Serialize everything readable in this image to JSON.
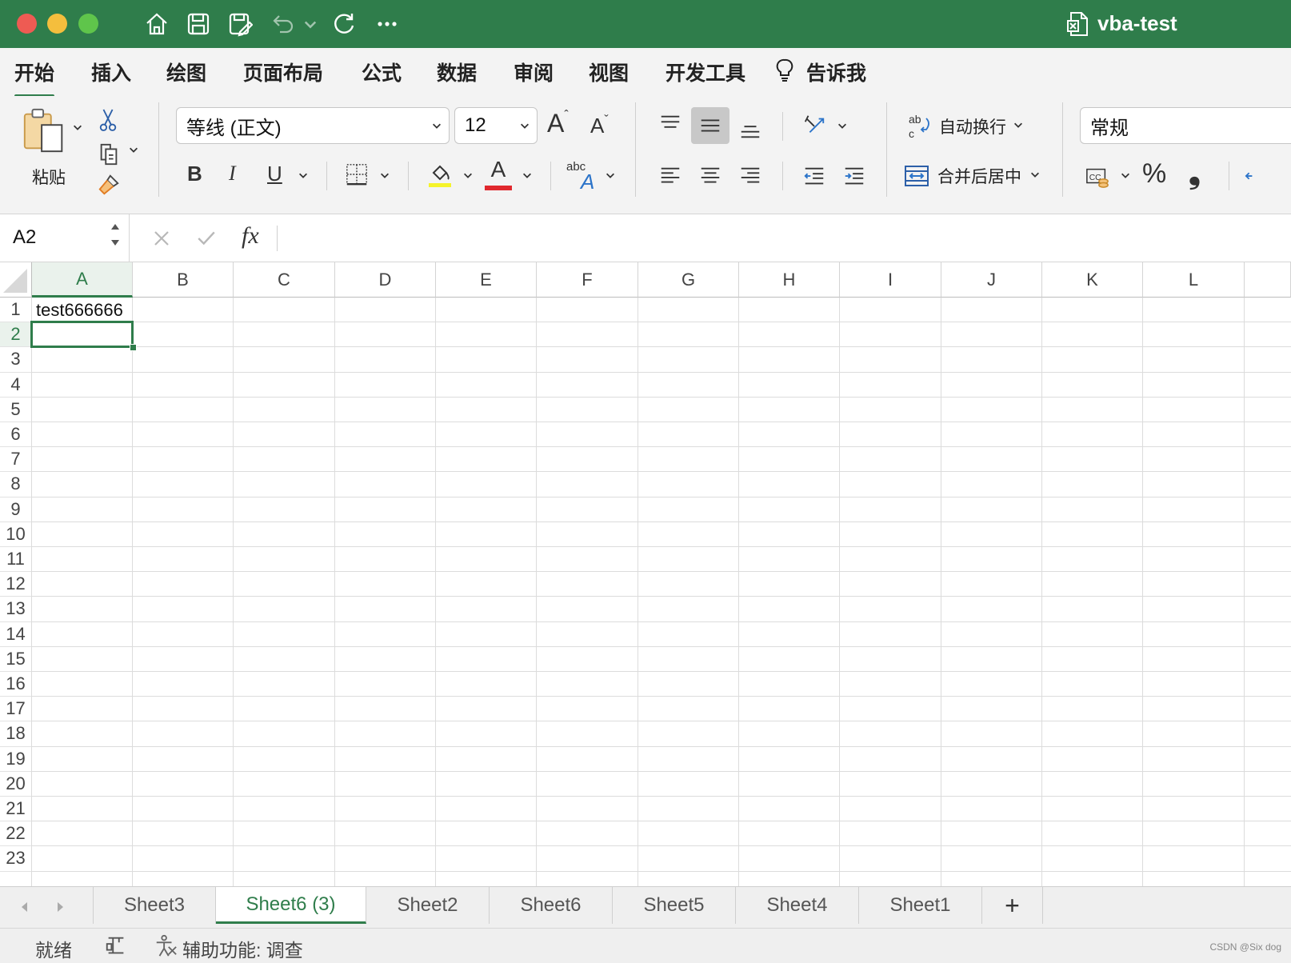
{
  "window": {
    "title": "vba-test"
  },
  "ribbon": {
    "tabs": [
      "开始",
      "插入",
      "绘图",
      "页面布局",
      "公式",
      "数据",
      "审阅",
      "视图",
      "开发工具",
      "告诉我"
    ],
    "active_tab": "开始",
    "paste_label": "粘贴",
    "font_name": "等线 (正文)",
    "font_size": "12",
    "wrap_text_label": "自动换行",
    "merge_center_label": "合并后居中",
    "number_format": "常规",
    "bold_glyph": "B",
    "italic_glyph": "I",
    "underline_glyph": "U",
    "grow_font_glyph": "A",
    "shrink_font_glyph": "A",
    "font_color_glyph": "A",
    "abc_label": "abc",
    "percent_glyph": "%",
    "comma_glyph": "❟",
    "highlight_color": "#f5f32a",
    "font_color": "#e0282e"
  },
  "formula_bar": {
    "name_box": "A2",
    "fx_label": "fx",
    "formula": ""
  },
  "grid": {
    "columns": [
      "A",
      "B",
      "C",
      "D",
      "E",
      "F",
      "G",
      "H",
      "I",
      "J",
      "K",
      "L"
    ],
    "rows": [
      "1",
      "2",
      "3",
      "4",
      "5",
      "6",
      "7",
      "8",
      "9",
      "10",
      "11",
      "12",
      "13",
      "14",
      "15",
      "16",
      "17",
      "18",
      "19",
      "20",
      "21",
      "22",
      "23"
    ],
    "cells": {
      "A1": "test666666"
    },
    "selected_cell": "A2"
  },
  "sheets": {
    "tabs": [
      "Sheet3",
      "Sheet6 (3)",
      "Sheet2",
      "Sheet6",
      "Sheet5",
      "Sheet4",
      "Sheet1"
    ],
    "active": "Sheet6 (3)",
    "add_label": "+"
  },
  "status_bar": {
    "ready": "就绪",
    "accessibility": "辅助功能: 调查",
    "watermark": "CSDN @Six dog"
  },
  "colors": {
    "accent": "#2f7d4b",
    "close": "#ee5b53",
    "minimize": "#f4be3d",
    "zoom": "#5fc54b"
  }
}
